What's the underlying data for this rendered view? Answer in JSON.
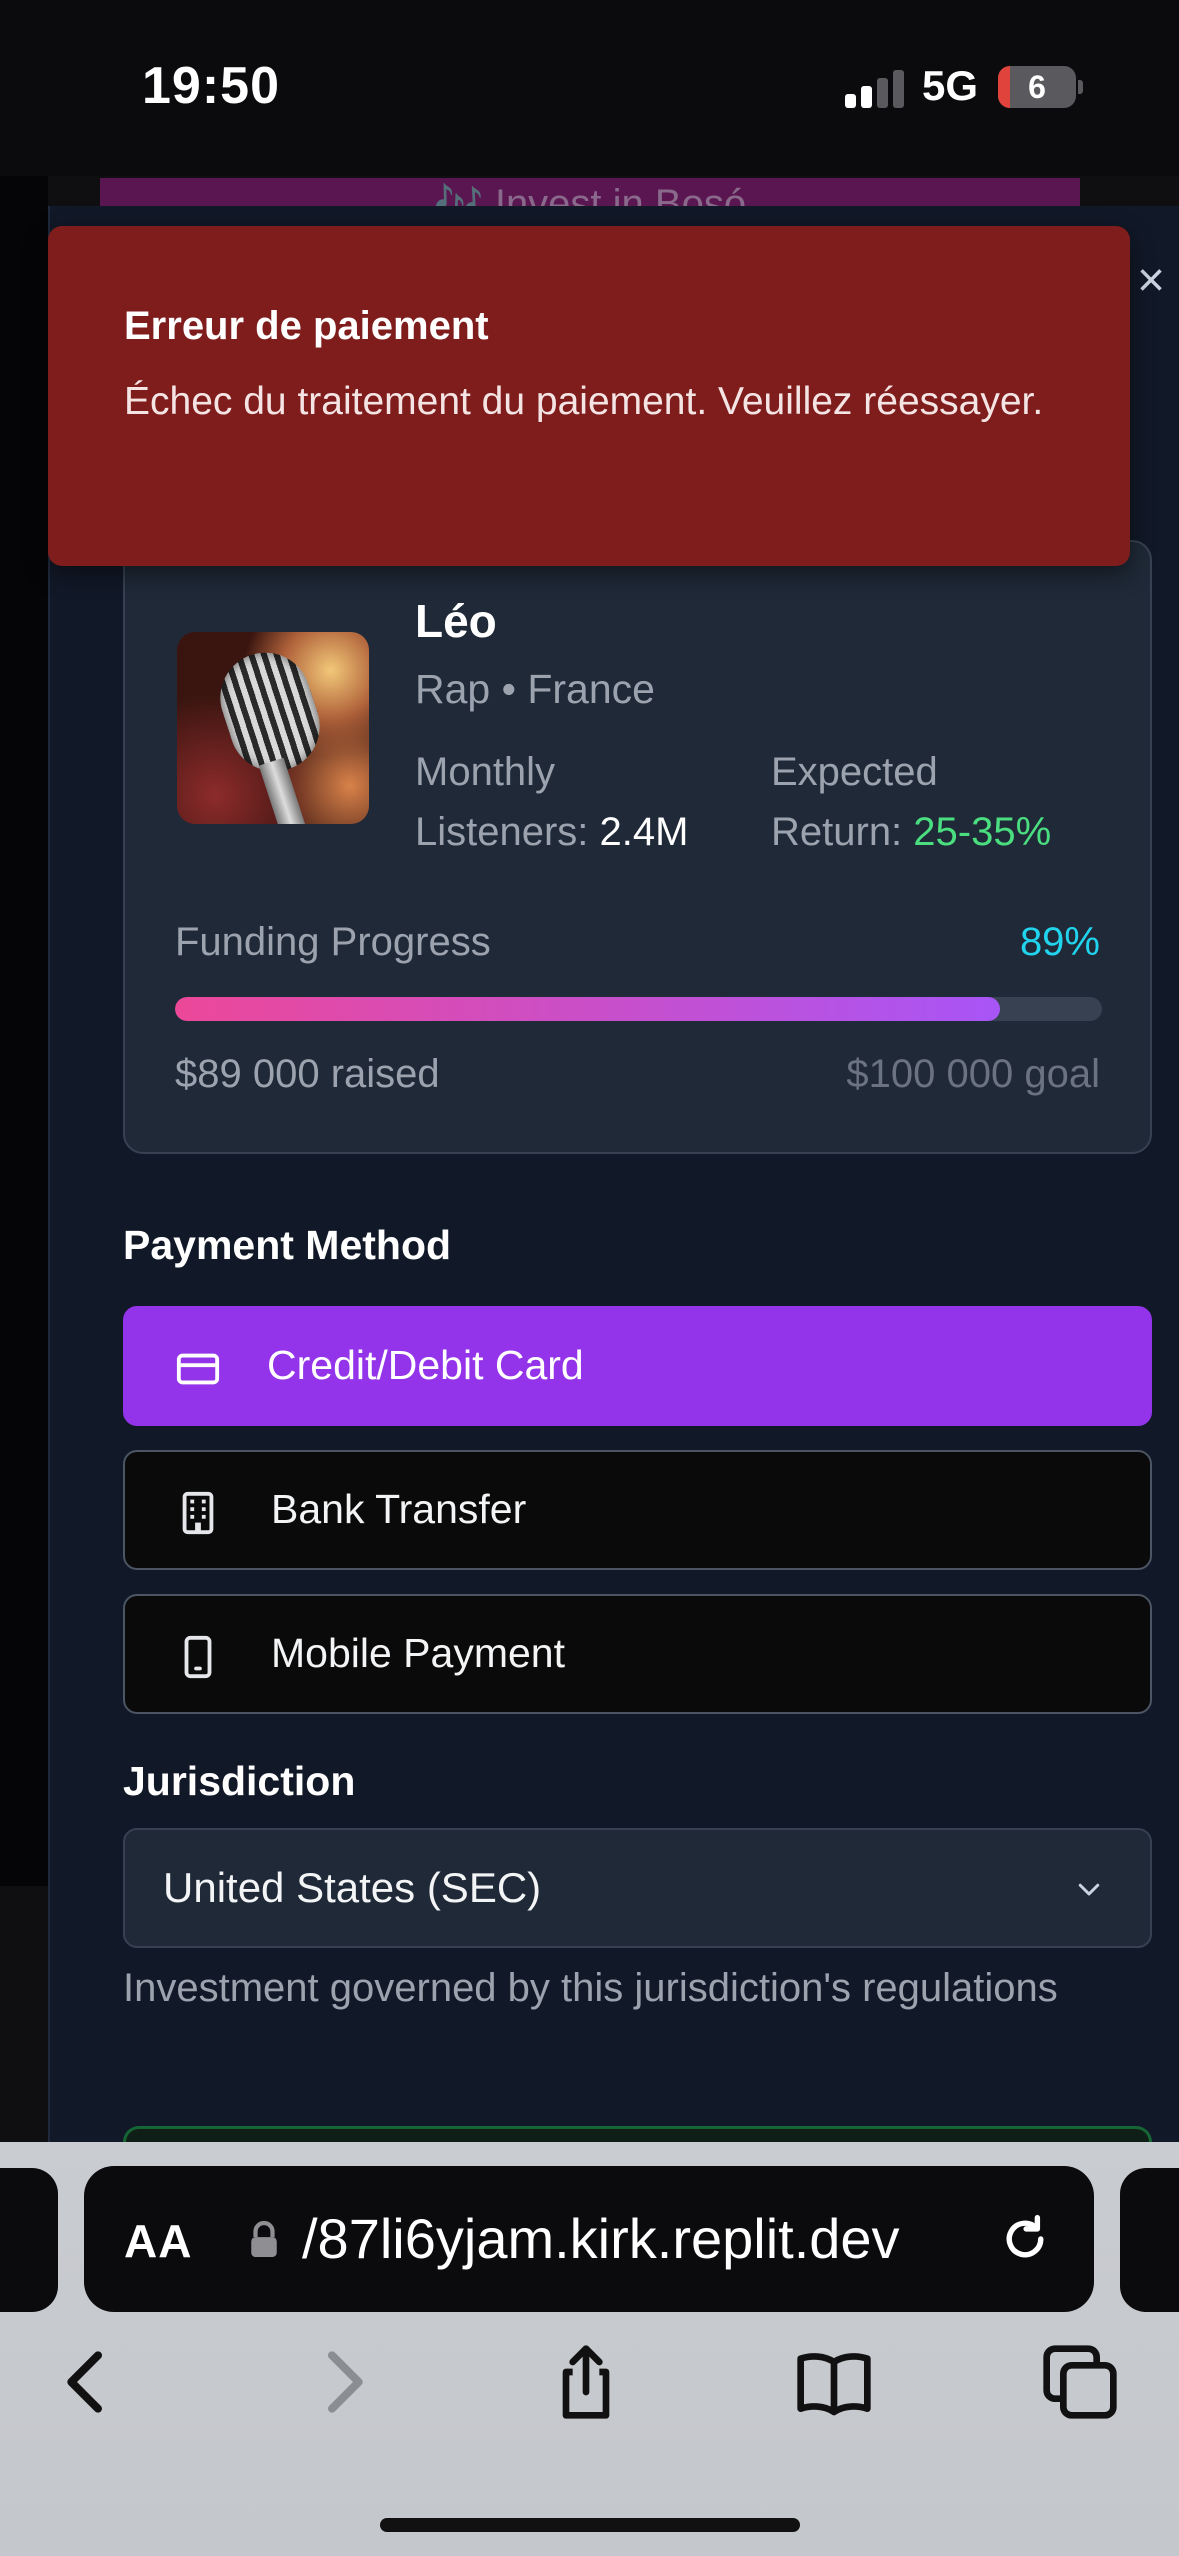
{
  "status_bar": {
    "time": "19:50",
    "network": "5G",
    "battery": "6"
  },
  "background": {
    "invest_banner": "🎶 Invest in Bosó"
  },
  "toast": {
    "title": "Erreur de paiement",
    "message": "Échec du traitement du paiement. Veuillez réessayer."
  },
  "artist": {
    "name": "Léo",
    "meta": "Rap • France",
    "listeners_label": "Monthly Listeners:",
    "listeners_value": "2.4M",
    "return_label": "Expected Return:",
    "return_value": "25-35%",
    "funding_label": "Funding Progress",
    "funding_percent": "89%",
    "funding_fraction": 0.89,
    "raised": "$89 000 raised",
    "goal": "$100 000 goal"
  },
  "payment": {
    "title": "Payment Method",
    "options": [
      {
        "label": "Credit/Debit Card",
        "icon": "credit-card-icon",
        "selected": true
      },
      {
        "label": "Bank Transfer",
        "icon": "building-icon",
        "selected": false
      },
      {
        "label": "Mobile Payment",
        "icon": "smartphone-icon",
        "selected": false
      }
    ]
  },
  "jurisdiction": {
    "title": "Jurisdiction",
    "selected": "United States (SEC)",
    "hint": "Investment governed by this jurisdiction's regulations"
  },
  "browser": {
    "aa_label": "AA",
    "url": "/87li6yjam.kirk.replit.dev"
  },
  "colors": {
    "accent": "#9333ea",
    "toast_bg": "#7f1d1d",
    "return_green": "#4ade80",
    "percent_cyan": "#22d3ee"
  }
}
